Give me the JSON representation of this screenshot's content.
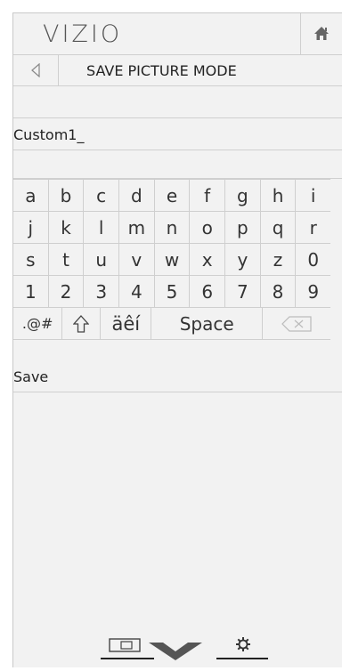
{
  "header": {
    "logo": "VIZIO"
  },
  "titlebar": {
    "title": "SAVE PICTURE MODE"
  },
  "input": {
    "value": "Custom1_"
  },
  "keyboard": {
    "rows": [
      [
        "a",
        "b",
        "c",
        "d",
        "e",
        "f",
        "g",
        "h",
        "i"
      ],
      [
        "j",
        "k",
        "l",
        "m",
        "n",
        "o",
        "p",
        "q",
        "r"
      ],
      [
        "s",
        "t",
        "u",
        "v",
        "w",
        "x",
        "y",
        "z",
        "0"
      ],
      [
        "1",
        "2",
        "3",
        "4",
        "5",
        "6",
        "7",
        "8",
        "9"
      ]
    ],
    "symbols_label": ".@#",
    "accents_label": "äêí",
    "space_label": "Space"
  },
  "save_label": "Save",
  "colors": {
    "panel": "#f2f2f2",
    "divider": "#cfcfcf",
    "text": "#222222"
  }
}
